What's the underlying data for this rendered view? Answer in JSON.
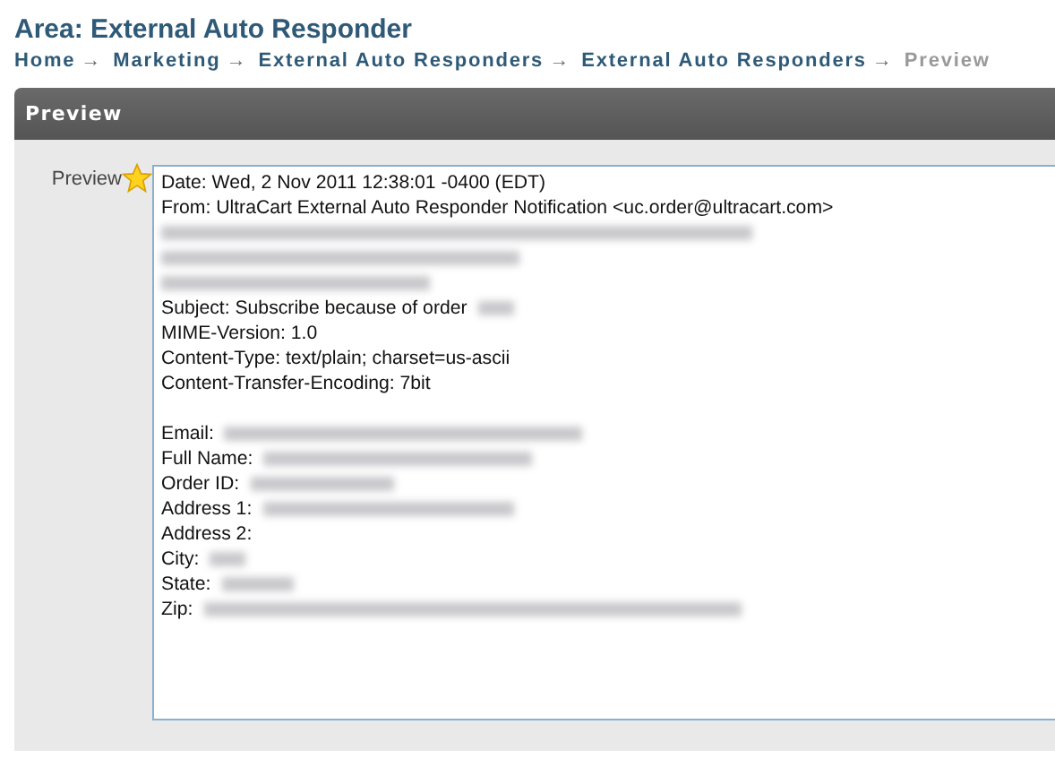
{
  "title": "Area: External Auto Responder",
  "breadcrumbs": [
    {
      "label": "Home",
      "current": false
    },
    {
      "label": "Marketing",
      "current": false
    },
    {
      "label": "External Auto Responders",
      "current": false
    },
    {
      "label": "External Auto Responders",
      "current": false
    },
    {
      "label": "Preview",
      "current": true
    }
  ],
  "breadcrumb_separator": "→",
  "panel": {
    "title": "Preview",
    "field_label": "Preview",
    "lines": [
      {
        "kind": "text",
        "text": "Date: Wed, 2 Nov 2011 12:38:01 -0400 (EDT)"
      },
      {
        "kind": "text",
        "text": "From: UltraCart External Auto Responder Notification <uc.order@ultracart.com>"
      },
      {
        "kind": "redacted"
      },
      {
        "kind": "redacted"
      },
      {
        "kind": "redacted"
      },
      {
        "kind": "partial",
        "text": "Subject: Subscribe because of order"
      },
      {
        "kind": "text",
        "text": "MIME-Version: 1.0"
      },
      {
        "kind": "text",
        "text": "Content-Type: text/plain; charset=us-ascii"
      },
      {
        "kind": "text",
        "text": "Content-Transfer-Encoding: 7bit"
      },
      {
        "kind": "blank"
      },
      {
        "kind": "partial",
        "text": "Email:"
      },
      {
        "kind": "partial",
        "text": "Full Name:"
      },
      {
        "kind": "partial",
        "text": "Order ID:"
      },
      {
        "kind": "partial",
        "text": "Address 1:"
      },
      {
        "kind": "text",
        "text": "Address 2:"
      },
      {
        "kind": "partial",
        "text": "City:"
      },
      {
        "kind": "partial",
        "text": "State:"
      },
      {
        "kind": "partial",
        "text": "Zip:"
      }
    ]
  }
}
